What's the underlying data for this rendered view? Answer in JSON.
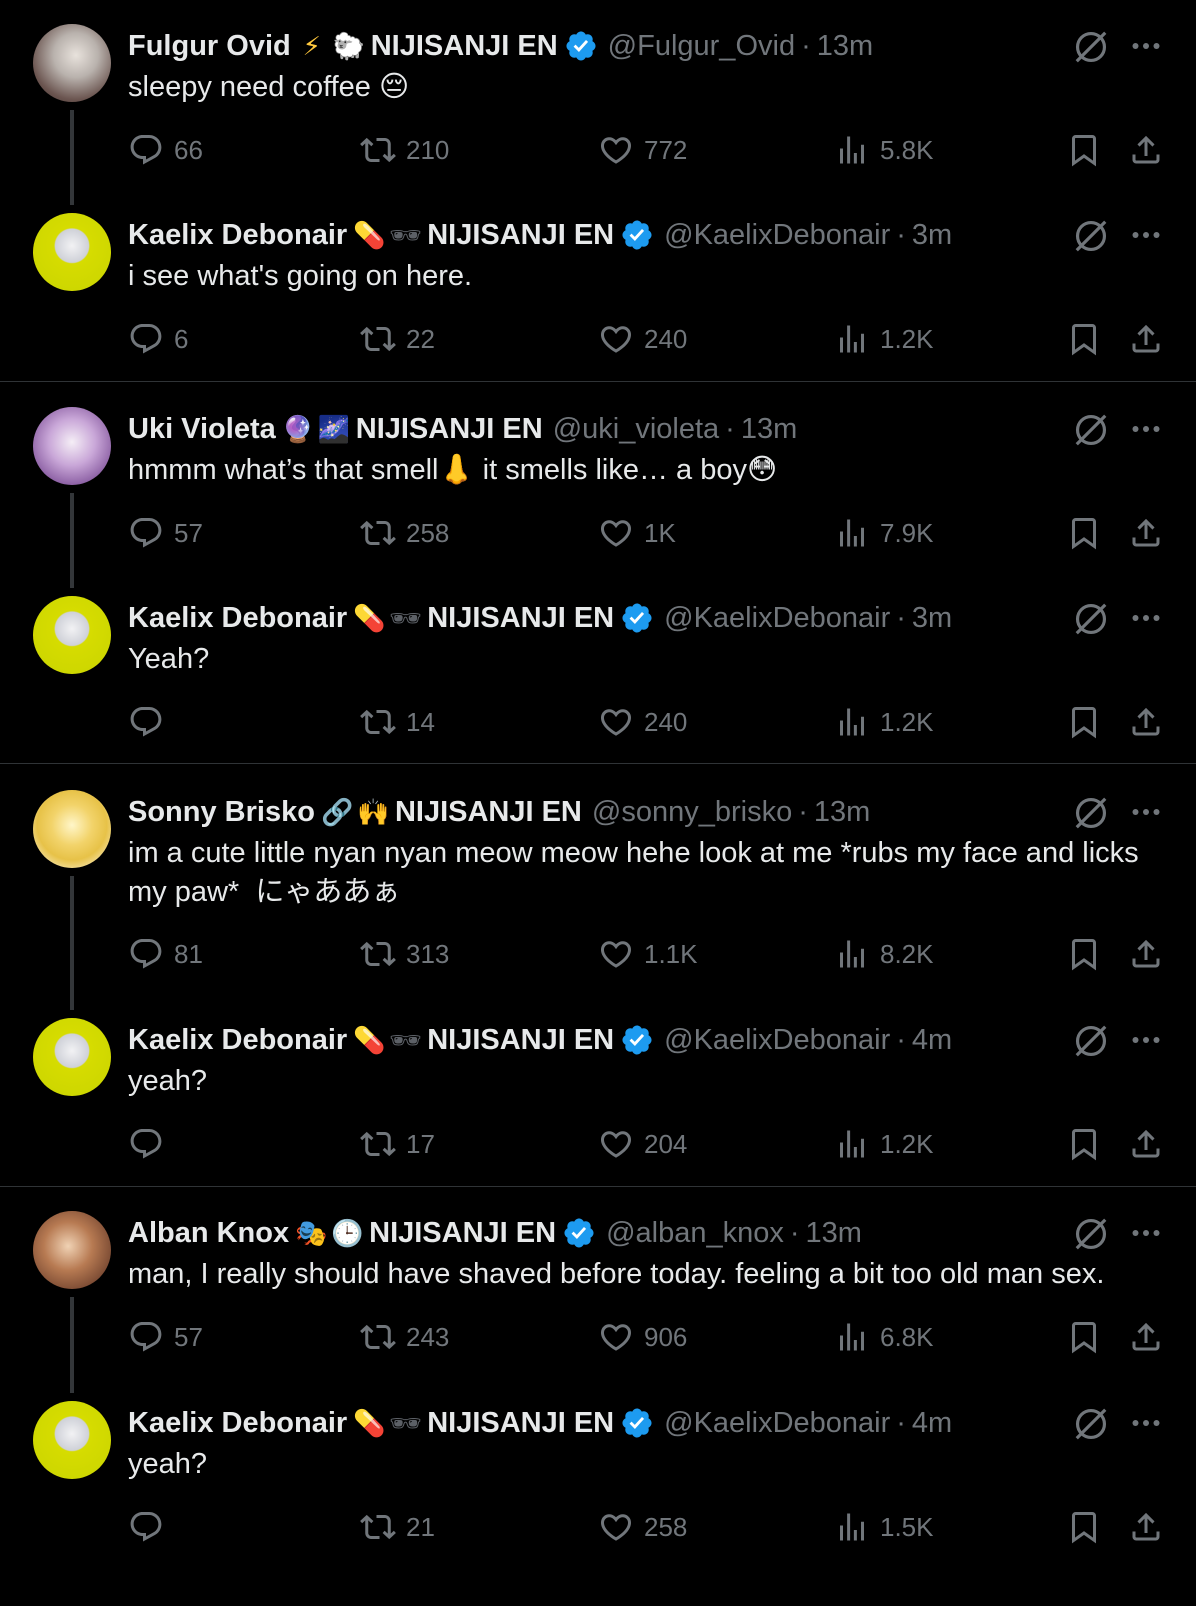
{
  "colors": {
    "background": "#000000",
    "text_primary": "#e7e9ea",
    "text_secondary": "#71767b",
    "verified_blue": "#1d9bf0",
    "divider": "#2f3336"
  },
  "threads": [
    {
      "parent": {
        "name": "Fulgur Ovid",
        "emojis": [
          "high-voltage-emoji",
          "sheep-emoji"
        ],
        "affiliation": "NIJISANJI EN",
        "verified": true,
        "handle": "@Fulgur_Ovid",
        "separator": "·",
        "time": "13m",
        "text": "sleepy need coffee 😔",
        "replies": "66",
        "reposts": "210",
        "likes": "772",
        "views": "5.8K"
      },
      "reply": {
        "name": "Kaelix Debonair",
        "emojis": [
          "pill-emoji",
          "sunglasses-emoji"
        ],
        "affiliation": "NIJISANJI EN",
        "verified": true,
        "handle": "@KaelixDebonair",
        "separator": "·",
        "time": "3m",
        "text": "i see what's going on here.",
        "replies": "6",
        "reposts": "22",
        "likes": "240",
        "views": "1.2K"
      }
    },
    {
      "parent": {
        "name": "Uki Violeta",
        "emojis": [
          "crystal-ball-emoji",
          "milky-way-emoji"
        ],
        "affiliation": "NIJISANJI EN",
        "verified": false,
        "handle": "@uki_violeta",
        "separator": "·",
        "time": "13m",
        "text": "hmmm what’s that smell👃 it smells like… a boy😳",
        "replies": "57",
        "reposts": "258",
        "likes": "1K",
        "views": "7.9K"
      },
      "reply": {
        "name": "Kaelix Debonair",
        "emojis": [
          "pill-emoji",
          "sunglasses-emoji"
        ],
        "affiliation": "NIJISANJI EN",
        "verified": true,
        "handle": "@KaelixDebonair",
        "separator": "·",
        "time": "3m",
        "text": "Yeah?",
        "replies": "",
        "reposts": "14",
        "likes": "240",
        "views": "1.2K"
      }
    },
    {
      "parent": {
        "name": "Sonny Brisko",
        "emojis": [
          "link-emoji",
          "raised-hands-emoji"
        ],
        "affiliation": "NIJISANJI EN",
        "verified": false,
        "handle": "@sonny_brisko",
        "separator": "·",
        "time": "13m",
        "text": "im a cute little nyan nyan meow meow hehe look at me *rubs my face and licks my paw*  にゃああぁ",
        "replies": "81",
        "reposts": "313",
        "likes": "1.1K",
        "views": "8.2K"
      },
      "reply": {
        "name": "Kaelix Debonair",
        "emojis": [
          "pill-emoji",
          "sunglasses-emoji"
        ],
        "affiliation": "NIJISANJI EN",
        "verified": true,
        "handle": "@KaelixDebonair",
        "separator": "·",
        "time": "4m",
        "text": "yeah?",
        "replies": "",
        "reposts": "17",
        "likes": "204",
        "views": "1.2K"
      }
    },
    {
      "parent": {
        "name": "Alban Knox",
        "emojis": [
          "performing-arts-emoji",
          "clock-emoji"
        ],
        "affiliation": "NIJISANJI EN",
        "verified": true,
        "handle": "@alban_knox",
        "separator": "·",
        "time": "13m",
        "text": "man, I really should have shaved before today. feeling a bit too old man sex.",
        "replies": "57",
        "reposts": "243",
        "likes": "906",
        "views": "6.8K"
      },
      "reply": {
        "name": "Kaelix Debonair",
        "emojis": [
          "pill-emoji",
          "sunglasses-emoji"
        ],
        "affiliation": "NIJISANJI EN",
        "verified": true,
        "handle": "@KaelixDebonair",
        "separator": "·",
        "time": "4m",
        "text": "yeah?",
        "replies": "",
        "reposts": "21",
        "likes": "258",
        "views": "1.5K"
      }
    }
  ]
}
